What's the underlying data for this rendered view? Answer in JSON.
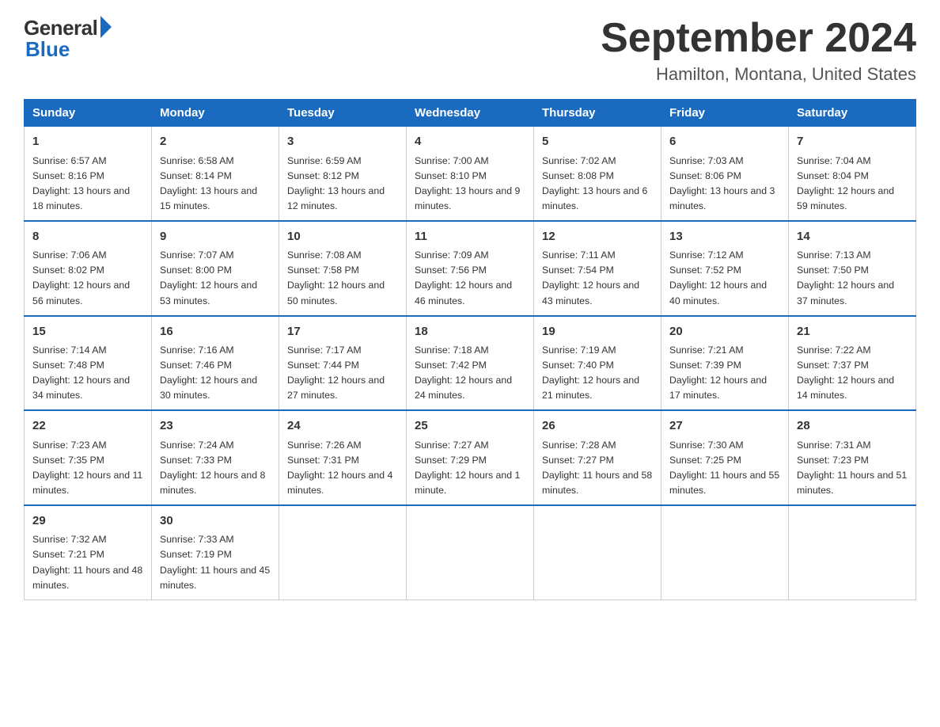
{
  "logo": {
    "general": "General",
    "blue": "Blue"
  },
  "title": "September 2024",
  "subtitle": "Hamilton, Montana, United States",
  "headers": [
    "Sunday",
    "Monday",
    "Tuesday",
    "Wednesday",
    "Thursday",
    "Friday",
    "Saturday"
  ],
  "weeks": [
    [
      {
        "day": "1",
        "sunrise": "6:57 AM",
        "sunset": "8:16 PM",
        "daylight": "13 hours and 18 minutes."
      },
      {
        "day": "2",
        "sunrise": "6:58 AM",
        "sunset": "8:14 PM",
        "daylight": "13 hours and 15 minutes."
      },
      {
        "day": "3",
        "sunrise": "6:59 AM",
        "sunset": "8:12 PM",
        "daylight": "13 hours and 12 minutes."
      },
      {
        "day": "4",
        "sunrise": "7:00 AM",
        "sunset": "8:10 PM",
        "daylight": "13 hours and 9 minutes."
      },
      {
        "day": "5",
        "sunrise": "7:02 AM",
        "sunset": "8:08 PM",
        "daylight": "13 hours and 6 minutes."
      },
      {
        "day": "6",
        "sunrise": "7:03 AM",
        "sunset": "8:06 PM",
        "daylight": "13 hours and 3 minutes."
      },
      {
        "day": "7",
        "sunrise": "7:04 AM",
        "sunset": "8:04 PM",
        "daylight": "12 hours and 59 minutes."
      }
    ],
    [
      {
        "day": "8",
        "sunrise": "7:06 AM",
        "sunset": "8:02 PM",
        "daylight": "12 hours and 56 minutes."
      },
      {
        "day": "9",
        "sunrise": "7:07 AM",
        "sunset": "8:00 PM",
        "daylight": "12 hours and 53 minutes."
      },
      {
        "day": "10",
        "sunrise": "7:08 AM",
        "sunset": "7:58 PM",
        "daylight": "12 hours and 50 minutes."
      },
      {
        "day": "11",
        "sunrise": "7:09 AM",
        "sunset": "7:56 PM",
        "daylight": "12 hours and 46 minutes."
      },
      {
        "day": "12",
        "sunrise": "7:11 AM",
        "sunset": "7:54 PM",
        "daylight": "12 hours and 43 minutes."
      },
      {
        "day": "13",
        "sunrise": "7:12 AM",
        "sunset": "7:52 PM",
        "daylight": "12 hours and 40 minutes."
      },
      {
        "day": "14",
        "sunrise": "7:13 AM",
        "sunset": "7:50 PM",
        "daylight": "12 hours and 37 minutes."
      }
    ],
    [
      {
        "day": "15",
        "sunrise": "7:14 AM",
        "sunset": "7:48 PM",
        "daylight": "12 hours and 34 minutes."
      },
      {
        "day": "16",
        "sunrise": "7:16 AM",
        "sunset": "7:46 PM",
        "daylight": "12 hours and 30 minutes."
      },
      {
        "day": "17",
        "sunrise": "7:17 AM",
        "sunset": "7:44 PM",
        "daylight": "12 hours and 27 minutes."
      },
      {
        "day": "18",
        "sunrise": "7:18 AM",
        "sunset": "7:42 PM",
        "daylight": "12 hours and 24 minutes."
      },
      {
        "day": "19",
        "sunrise": "7:19 AM",
        "sunset": "7:40 PM",
        "daylight": "12 hours and 21 minutes."
      },
      {
        "day": "20",
        "sunrise": "7:21 AM",
        "sunset": "7:39 PM",
        "daylight": "12 hours and 17 minutes."
      },
      {
        "day": "21",
        "sunrise": "7:22 AM",
        "sunset": "7:37 PM",
        "daylight": "12 hours and 14 minutes."
      }
    ],
    [
      {
        "day": "22",
        "sunrise": "7:23 AM",
        "sunset": "7:35 PM",
        "daylight": "12 hours and 11 minutes."
      },
      {
        "day": "23",
        "sunrise": "7:24 AM",
        "sunset": "7:33 PM",
        "daylight": "12 hours and 8 minutes."
      },
      {
        "day": "24",
        "sunrise": "7:26 AM",
        "sunset": "7:31 PM",
        "daylight": "12 hours and 4 minutes."
      },
      {
        "day": "25",
        "sunrise": "7:27 AM",
        "sunset": "7:29 PM",
        "daylight": "12 hours and 1 minute."
      },
      {
        "day": "26",
        "sunrise": "7:28 AM",
        "sunset": "7:27 PM",
        "daylight": "11 hours and 58 minutes."
      },
      {
        "day": "27",
        "sunrise": "7:30 AM",
        "sunset": "7:25 PM",
        "daylight": "11 hours and 55 minutes."
      },
      {
        "day": "28",
        "sunrise": "7:31 AM",
        "sunset": "7:23 PM",
        "daylight": "11 hours and 51 minutes."
      }
    ],
    [
      {
        "day": "29",
        "sunrise": "7:32 AM",
        "sunset": "7:21 PM",
        "daylight": "11 hours and 48 minutes."
      },
      {
        "day": "30",
        "sunrise": "7:33 AM",
        "sunset": "7:19 PM",
        "daylight": "11 hours and 45 minutes."
      },
      null,
      null,
      null,
      null,
      null
    ]
  ],
  "labels": {
    "sunrise": "Sunrise:",
    "sunset": "Sunset:",
    "daylight": "Daylight:"
  }
}
